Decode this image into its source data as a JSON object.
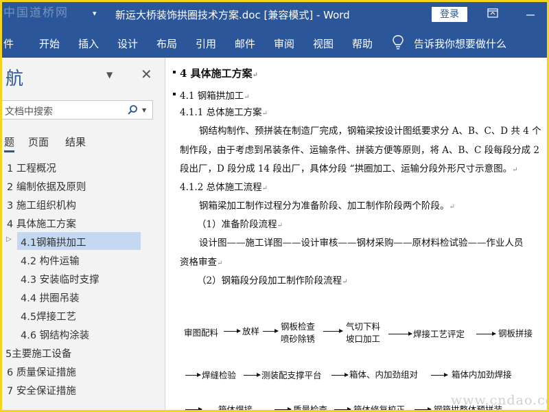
{
  "watermark_top": "中国道桥网",
  "title_bar": {
    "title": "新运大桥装饰拱圈技术方案.doc [兼容模式]  -  Word",
    "login_label": "登录",
    "qa_arrow": "▾"
  },
  "ribbon": {
    "tabs": [
      "件",
      "开始",
      "插入",
      "设计",
      "布局",
      "引用",
      "邮件",
      "审阅",
      "视图",
      "帮助"
    ],
    "tell_me": "告诉我你想要做什么"
  },
  "nav_pane": {
    "title": "航",
    "search_placeholder": "文档中搜索",
    "tabs": [
      "题",
      "页面",
      "结果"
    ],
    "items": [
      {
        "label": "1 工程概况",
        "level": 1
      },
      {
        "label": "2 编制依据及原则",
        "level": 1
      },
      {
        "label": "3 施工组织机构",
        "level": 1
      },
      {
        "label": "4 具体施工方案",
        "level": 1
      },
      {
        "label": "4.1钢箱拱加工",
        "level": 2,
        "selected": true
      },
      {
        "label": "4.2 构件运输",
        "level": 2
      },
      {
        "label": "4.3 安装临时支撑",
        "level": 2
      },
      {
        "label": "4.4 拱圈吊装",
        "level": 2
      },
      {
        "label": "4.5焊接工艺",
        "level": 2
      },
      {
        "label": "4.6 钢结构涂装",
        "level": 2
      },
      {
        "label": "5主要施工设备",
        "level": 1
      },
      {
        "label": "6 质量保证措施",
        "level": 1
      },
      {
        "label": "7 安全保证措施",
        "level": 1
      }
    ]
  },
  "document": {
    "heading": "4 具体施工方案",
    "h41": "4.1 钢箱拱加工",
    "h411": "4.1.1 总体施工方案",
    "p1_line1": "钢结构制作、预拼装在制造厂完成，钢箱梁按设计图纸要求分 A、B、C、D 共 4 个",
    "p1_line2": "制作段，由于考虑到吊装条件、运输条件、拼装方便等原则，将 A、B、C 段每段分成 2",
    "p1_line3": "段出厂，D 段分成 14 段出厂，具体分段 “拱圈加工、运输分段外形尺寸示意图。",
    "h412": "4.1.2 总体施工流程",
    "p2": "钢箱梁加工制作过程分为准备阶段、加工制作阶段两个阶段。",
    "p3": "（1）准备阶段流程",
    "p4_line1": "设计图——施工详图——设计审核——钢材采购——原材料检试验——作业人员",
    "p4_line2": "资格审查",
    "p5": "（2）钢箱段分段加工制作阶段流程",
    "flow_row1": [
      "审图配料",
      "放样",
      "钢板检查",
      "喷砂除锈",
      "气切下料",
      "坡口加工",
      "焊接工艺评定",
      "钢板拼接"
    ],
    "flow_row2": [
      "焊缝检验",
      "测装配支撑平台",
      "箱体、内加劲组对",
      "箱体内加劲焊接"
    ],
    "flow_row3": [
      "箱体焊接",
      "质量检查",
      "箱体修复校正",
      "钢箱拱整体预拼装"
    ],
    "para_mark": "↵"
  },
  "watermark_bottom": "www.cndao.com",
  "colors": {
    "ribbon": "#2b579a",
    "nav_bg": "#f3f3f3",
    "selected": "#c5d8f1",
    "frame": "#f5d51a"
  }
}
